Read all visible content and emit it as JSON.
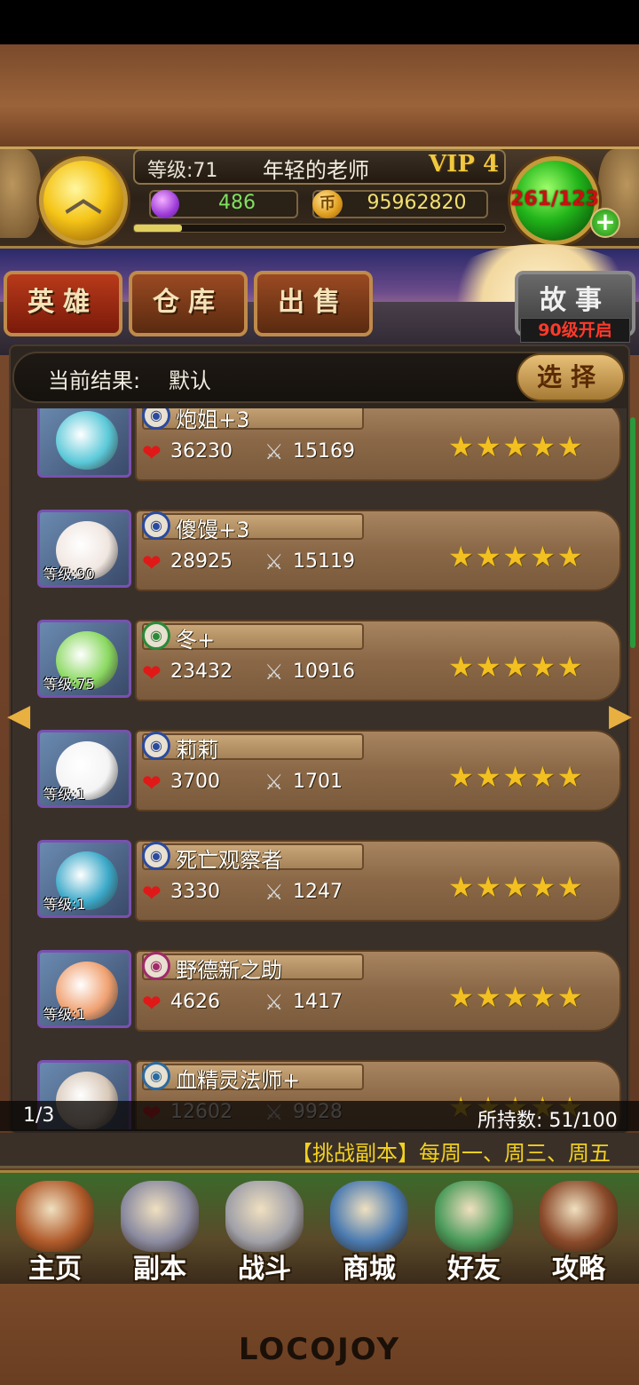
{
  "player": {
    "level_label": "等级:71",
    "name": "年轻的老师",
    "vip": "VIP 4",
    "gems": "486",
    "gold": "95962820",
    "gold_icon_glyph": "币",
    "energy": "261/123",
    "xp_fraction": 0.13
  },
  "tabs": {
    "hero": "英雄",
    "warehouse": "仓库",
    "sell": "出售",
    "story": "故事",
    "story_badge": "90级开启"
  },
  "filter": {
    "label": "当前结果:",
    "value": "默认",
    "select": "选择"
  },
  "heroes": [
    {
      "name": "炮姐+3",
      "hp": "36230",
      "atk": "15169",
      "level": "",
      "stars": 5,
      "class_color": "#2a4aa0",
      "face": "#5ac8d8"
    },
    {
      "name": "傻馒+3",
      "hp": "28925",
      "atk": "15119",
      "level": "等级:90",
      "stars": 5,
      "class_color": "#2a4aa0",
      "face": "#f0e6e0"
    },
    {
      "name": "冬+",
      "hp": "23432",
      "atk": "10916",
      "level": "等级:75",
      "stars": 5,
      "class_color": "#2a8a3a",
      "face": "#8ad860"
    },
    {
      "name": "莉莉",
      "hp": "3700",
      "atk": "1701",
      "level": "等级:1",
      "stars": 5,
      "class_color": "#2a4aa0",
      "face": "#f4f4f4"
    },
    {
      "name": "死亡观察者",
      "hp": "3330",
      "atk": "1247",
      "level": "等级:1",
      "stars": 5,
      "class_color": "#2a4aa0",
      "face": "#3aa8c8"
    },
    {
      "name": "野德新之助",
      "hp": "4626",
      "atk": "1417",
      "level": "等级:1",
      "stars": 5,
      "class_color": "#a02a6a",
      "face": "#f0a070"
    },
    {
      "name": "血精灵法师+",
      "hp": "12602",
      "atk": "9928",
      "level": "",
      "stars": 5,
      "class_color": "#2a6aa0",
      "face": "#d8c8b8"
    }
  ],
  "status": {
    "page": "1/3",
    "held": "所持数: 51/100"
  },
  "ticker": "【挑战副本】每周一、周三、周五",
  "nav": [
    {
      "label": "主页",
      "icon": "house-icon",
      "color": "#b05a2a"
    },
    {
      "label": "副本",
      "icon": "skull-icon",
      "color": "#8a8aa0"
    },
    {
      "label": "战斗",
      "icon": "sword-icon",
      "color": "#a0a0a8"
    },
    {
      "label": "商城",
      "icon": "monster-icon",
      "color": "#4a7ab0"
    },
    {
      "label": "好友",
      "icon": "friends-icon",
      "color": "#4a9a5a"
    },
    {
      "label": "攻略",
      "icon": "book-icon",
      "color": "#8a4a2a"
    }
  ],
  "logo": "LOCOJOY",
  "icons": {
    "up": "chevron-up-icon",
    "heart": "heart-icon",
    "attack": "crossed-swords-icon",
    "star": "star-icon",
    "gem": "gem-icon",
    "gold": "gold-coin-icon"
  }
}
